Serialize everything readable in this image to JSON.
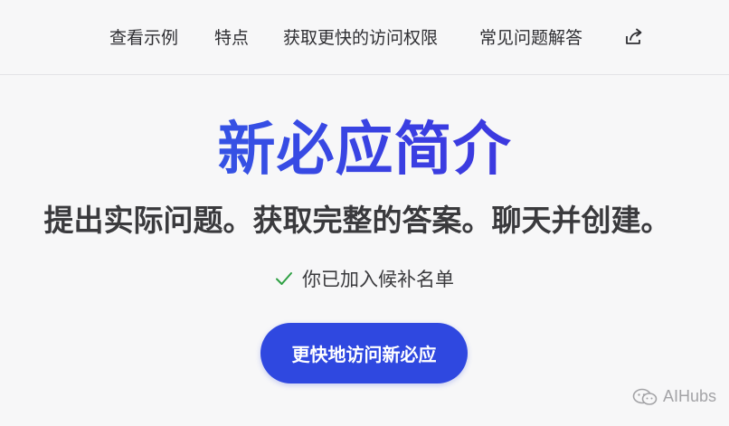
{
  "nav": {
    "items": [
      {
        "label": "查看示例"
      },
      {
        "label": "特点"
      },
      {
        "label": "获取更快的访问权限"
      },
      {
        "label": "常见问题解答"
      }
    ],
    "share_icon": "share-icon"
  },
  "hero": {
    "title": "新必应简介",
    "subtitle": "提出实际问题。获取完整的答案。聊天并创建。",
    "waitlist_status": "你已加入候补名单",
    "status_icon": "check-icon",
    "cta_label": "更快地访问新必应"
  },
  "watermark": {
    "text": "AIHubs",
    "icon": "wechat-icon"
  },
  "colors": {
    "accent": "#2f48e0",
    "title_gradient_start": "#2f6ae8",
    "title_gradient_end": "#3f2cd9",
    "check": "#2ea043",
    "background": "#f7f7f8"
  }
}
